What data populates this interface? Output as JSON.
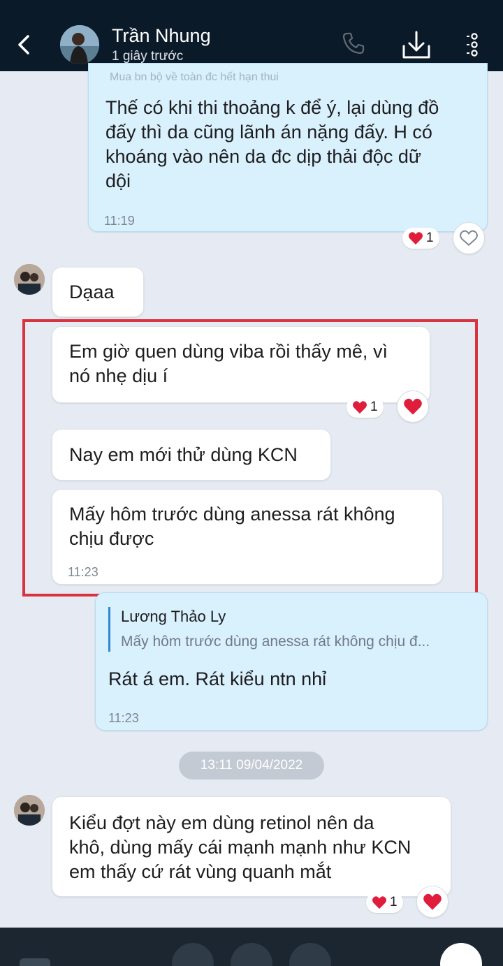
{
  "header": {
    "contact_name": "Trần Nhung",
    "status": "1 giây trước"
  },
  "messages": [
    {
      "id": "m1",
      "direction": "sent",
      "quote_remnant": "Mua bn bộ về toàn đc hết hạn thui",
      "text": "Thế có khi thi thoảng k để ý, lại dùng đồ\nđấy thì da cũng lãnh án nặng đấy. H có\nkhoáng vào nên da đc dịp thải độc dữ\ndội",
      "time": "11:19",
      "reaction_count": "1"
    },
    {
      "id": "m2",
      "direction": "received",
      "text": "Dạaa"
    },
    {
      "id": "m3",
      "direction": "received",
      "text": "Em giờ quen dùng viba rồi thấy mê, vì\nnó nhẹ dịu í",
      "reaction_count": "1"
    },
    {
      "id": "m4",
      "direction": "received",
      "text": "Nay em mới thử dùng KCN"
    },
    {
      "id": "m5",
      "direction": "received",
      "text": "Mấy hôm trước dùng anessa rát không\nchịu được",
      "time": "11:23"
    },
    {
      "id": "m6",
      "direction": "sent",
      "quote_author": "Lương Thảo Ly",
      "quote_text": "Mấy hôm trước dùng anessa rát không chịu đ...",
      "text": "Rát á em. Rát kiểu ntn nhỉ",
      "time": "11:23"
    },
    {
      "id": "m7",
      "direction": "received",
      "text": "Kiểu đợt này em dùng retinol nên da\nkhô, dùng mấy cái mạnh mạnh như KCN\nem thấy cứ rát vùng quanh mắt",
      "reaction_count": "1"
    }
  ],
  "date_separator": "13:11 09/04/2022",
  "colors": {
    "header_bg": "#0b1a29",
    "chat_bg": "#e6ebf3",
    "sent_bubble": "#d9f0fd",
    "received_bubble": "#ffffff",
    "heart": "#e01e3c",
    "highlight_border": "#d7343f",
    "quote_bar": "#2f87cf"
  },
  "icons": [
    "back-arrow-icon",
    "phone-icon",
    "download-icon",
    "more-vertical-icon",
    "heart-icon",
    "heart-outline-icon"
  ]
}
